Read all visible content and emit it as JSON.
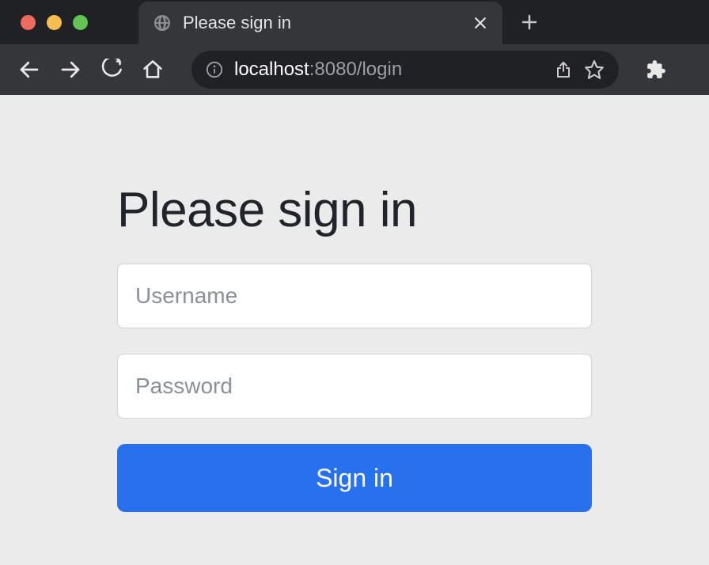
{
  "browser": {
    "tab": {
      "title": "Please sign in"
    },
    "url": {
      "host": "localhost",
      "rest": ":8080/login"
    }
  },
  "login": {
    "heading": "Please sign in",
    "username_placeholder": "Username",
    "password_placeholder": "Password",
    "submit_label": "Sign in"
  }
}
